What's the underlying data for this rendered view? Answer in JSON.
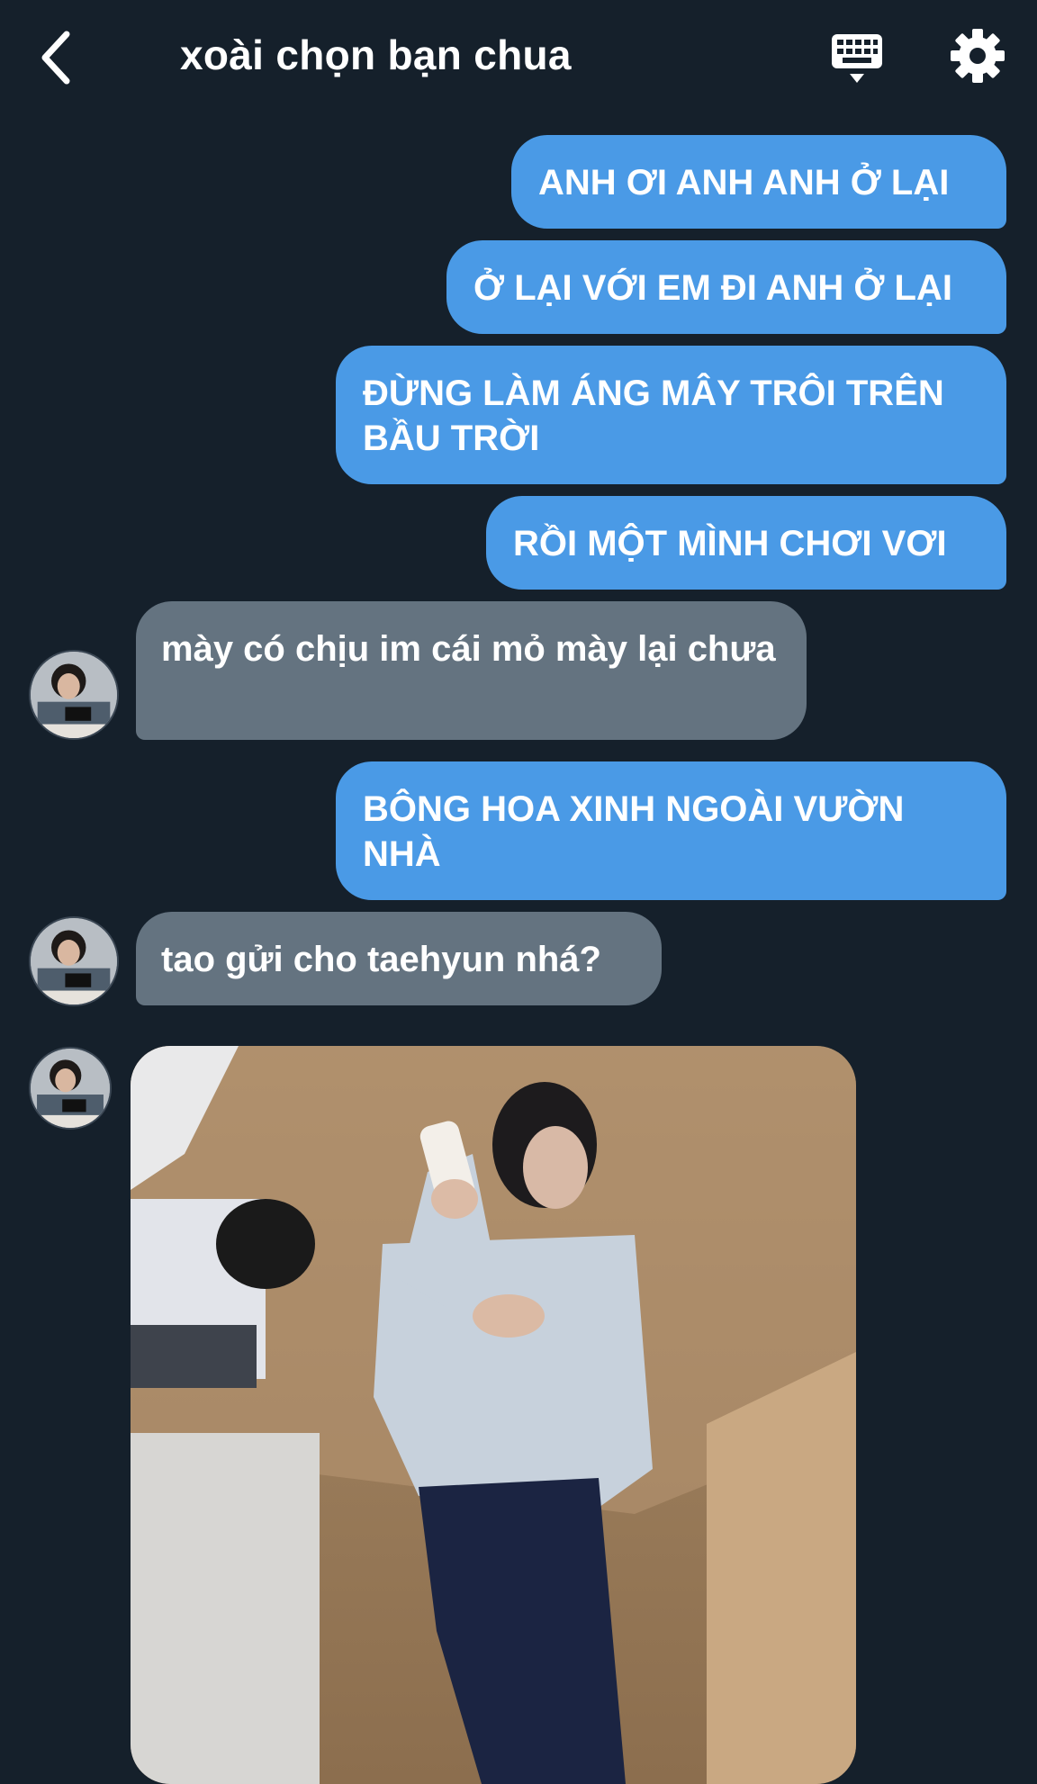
{
  "header": {
    "title": "xoài chọn bạn chua",
    "back_icon": "chevron-left-icon",
    "keyboard_icon": "keyboard-icon",
    "settings_icon": "gear-icon"
  },
  "colors": {
    "background": "#15202b",
    "outgoing_bubble": "#4a9ae6",
    "incoming_bubble": "#647380",
    "text": "#ffffff"
  },
  "messages": [
    {
      "direction": "out",
      "text": "ANH ƠI ANH ANH Ở LẠI"
    },
    {
      "direction": "out",
      "text": "Ở LẠI VỚI EM ĐI ANH Ở LẠI"
    },
    {
      "direction": "out",
      "text": "ĐỪNG LÀM ÁNG MÂY TRÔI TRÊN BẦU TRỜI"
    },
    {
      "direction": "out",
      "text": "RỒI MỘT MÌNH CHƠI VƠI"
    },
    {
      "direction": "in",
      "text": "mày có chịu im cái mỏ mày lại chưa"
    },
    {
      "direction": "out",
      "text": "BÔNG HOA XINH NGOÀI VƯỜN NHÀ"
    },
    {
      "direction": "in",
      "text": "tao gửi cho taehyun nhá?"
    },
    {
      "direction": "in",
      "type": "image",
      "icon": "photo-of-person-icon"
    }
  ]
}
